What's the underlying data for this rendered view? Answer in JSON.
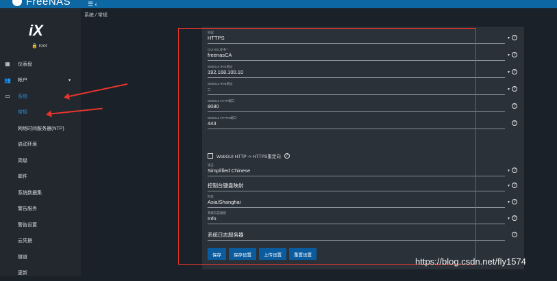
{
  "topbar": {
    "logo": "FreeNAS",
    "menu": "☰ ‹"
  },
  "sidebar": {
    "brand": "iX",
    "user": "🔒 root",
    "items": [
      {
        "icon": "▦",
        "label": "仪表盘",
        "state": "normal"
      },
      {
        "icon": "👥",
        "label": "帐户",
        "caret": "▾",
        "state": "normal"
      },
      {
        "icon": "▭",
        "label": "系统",
        "state": "active-parent"
      },
      {
        "label": "常规",
        "state": "active"
      },
      {
        "label": "网络时间服务器(NTP)",
        "state": "normal"
      },
      {
        "label": "启动环境",
        "state": "normal"
      },
      {
        "label": "高级",
        "state": "normal"
      },
      {
        "label": "邮件",
        "state": "normal"
      },
      {
        "label": "系统数据集",
        "state": "normal"
      },
      {
        "label": "警告服务",
        "state": "normal"
      },
      {
        "label": "警告设置",
        "state": "normal"
      },
      {
        "label": "云凭据",
        "state": "normal"
      },
      {
        "label": "隧道",
        "state": "normal"
      },
      {
        "label": "更新",
        "state": "normal"
      }
    ]
  },
  "breadcrumb": "系统 / 常规",
  "form": {
    "fields": [
      {
        "label": "协议",
        "value": "HTTPS",
        "dropdown": true
      },
      {
        "label": "GUI SSL证书 *",
        "value": "freenasCA",
        "dropdown": true
      },
      {
        "label": "WebGUI IPv4地址",
        "value": "192.168.100.10",
        "dropdown": true
      },
      {
        "label": "WebGUI IPv6地址",
        "value": "::",
        "dropdown": true
      },
      {
        "label": "WebGUI HTTP端口",
        "value": "8080",
        "dropdown": false
      },
      {
        "label": "WebGUI HTTPS端口",
        "value": "443",
        "dropdown": false
      }
    ],
    "checkbox_label": "WebGUI HTTP -> HTTPS重定向",
    "fields2": [
      {
        "label": "语言",
        "value": "Simplified Chinese",
        "dropdown": true
      },
      {
        "label": "",
        "value": "控制台键盘映射",
        "dropdown": true
      },
      {
        "label": "时区",
        "value": "Asia/Shanghai",
        "dropdown": true
      },
      {
        "label": "系统日志级别",
        "value": "Info",
        "dropdown": true
      },
      {
        "label": "",
        "value": "系统日志服务器",
        "dropdown": false
      }
    ],
    "buttons": [
      "保存",
      "保存设置",
      "上传设置",
      "重置设置"
    ],
    "help_glyph": "?",
    "dropdown_glyph": "▼"
  },
  "watermark": "https://blog.csdn.net/fly1574",
  "colors": {
    "accent": "#0b5c9e",
    "highlight": "#e8352c",
    "active": "#2a8bd2"
  }
}
